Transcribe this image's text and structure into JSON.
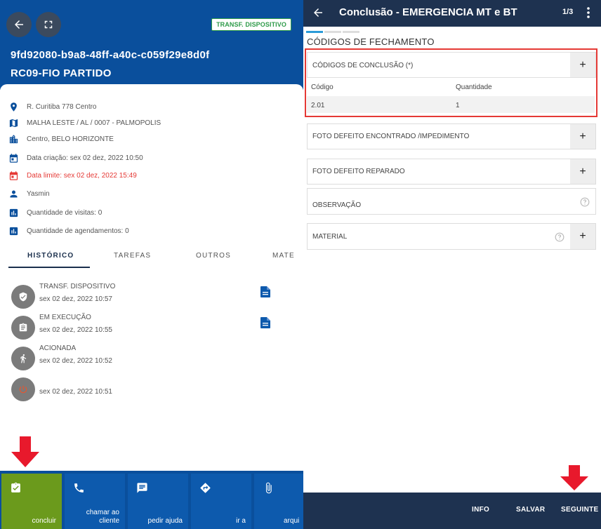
{
  "left": {
    "status_badge": "TRANSF. DISPOSITIVO",
    "order_id": "9fd92080-b9a8-48ff-a40c-c059f29e8d0f",
    "order_title": "RC09-FIO PARTIDO",
    "info": {
      "address": "R. Curitiba 778 Centro",
      "network": "MALHA LESTE / AL / 0007 - PALMOPOLIS",
      "district": "Centro, BELO HORIZONTE",
      "created": "Data criação: sex 02 dez, 2022 10:50",
      "deadline": "Data limite: sex 02 dez, 2022 15:49",
      "user": "Yasmin",
      "visits": "Quantidade de visitas: 0",
      "schedules": "Quantidade de agendamentos: 0"
    },
    "tabs": [
      "HISTÓRICO",
      "TAREFAS",
      "OUTROS",
      "MATE"
    ],
    "history": [
      {
        "label": "TRANSF. DISPOSITIVO",
        "time": "sex 02 dez, 2022 10:57"
      },
      {
        "label": "EM EXECUÇÃO",
        "time": "sex 02 dez, 2022 10:55"
      },
      {
        "label": "ACIONADA",
        "time": "sex 02 dez, 2022 10:52"
      },
      {
        "label": "",
        "time": "sex 02 dez, 2022 10:51"
      }
    ],
    "bottom_actions": [
      "concluir",
      "chamar ao cliente",
      "pedir ajuda",
      "ir a",
      "arqui"
    ],
    "colors": {
      "header": "#0a4f9c",
      "concluir": "#6b9a1c",
      "deadline": "#e53935"
    }
  },
  "right": {
    "title": "Conclusão - EMERGENCIA MT e BT",
    "page": "1/3",
    "section_title": "CÓDIGOS DE FECHAMENTO",
    "codes_card": {
      "title": "CÓDIGOS DE CONCLUSÃO (*)",
      "columns": [
        "Código",
        "Quantidade"
      ],
      "rows": [
        [
          "2.01",
          "1"
        ]
      ]
    },
    "cards": [
      {
        "title": "FOTO DEFEITO ENCONTRADO /IMPEDIMENTO"
      },
      {
        "title": "FOTO DEFEITO REPARADO"
      },
      {
        "title": "OBSERVAÇÃO"
      },
      {
        "title": "MATERIAL"
      }
    ],
    "plus": "+",
    "bottom_actions": [
      "INFO",
      "SALVAR",
      "SEGUINTE"
    ],
    "colors": {
      "topbar": "#1e3250",
      "highlight": "#e53935",
      "step_active": "#2a9bd8"
    }
  }
}
